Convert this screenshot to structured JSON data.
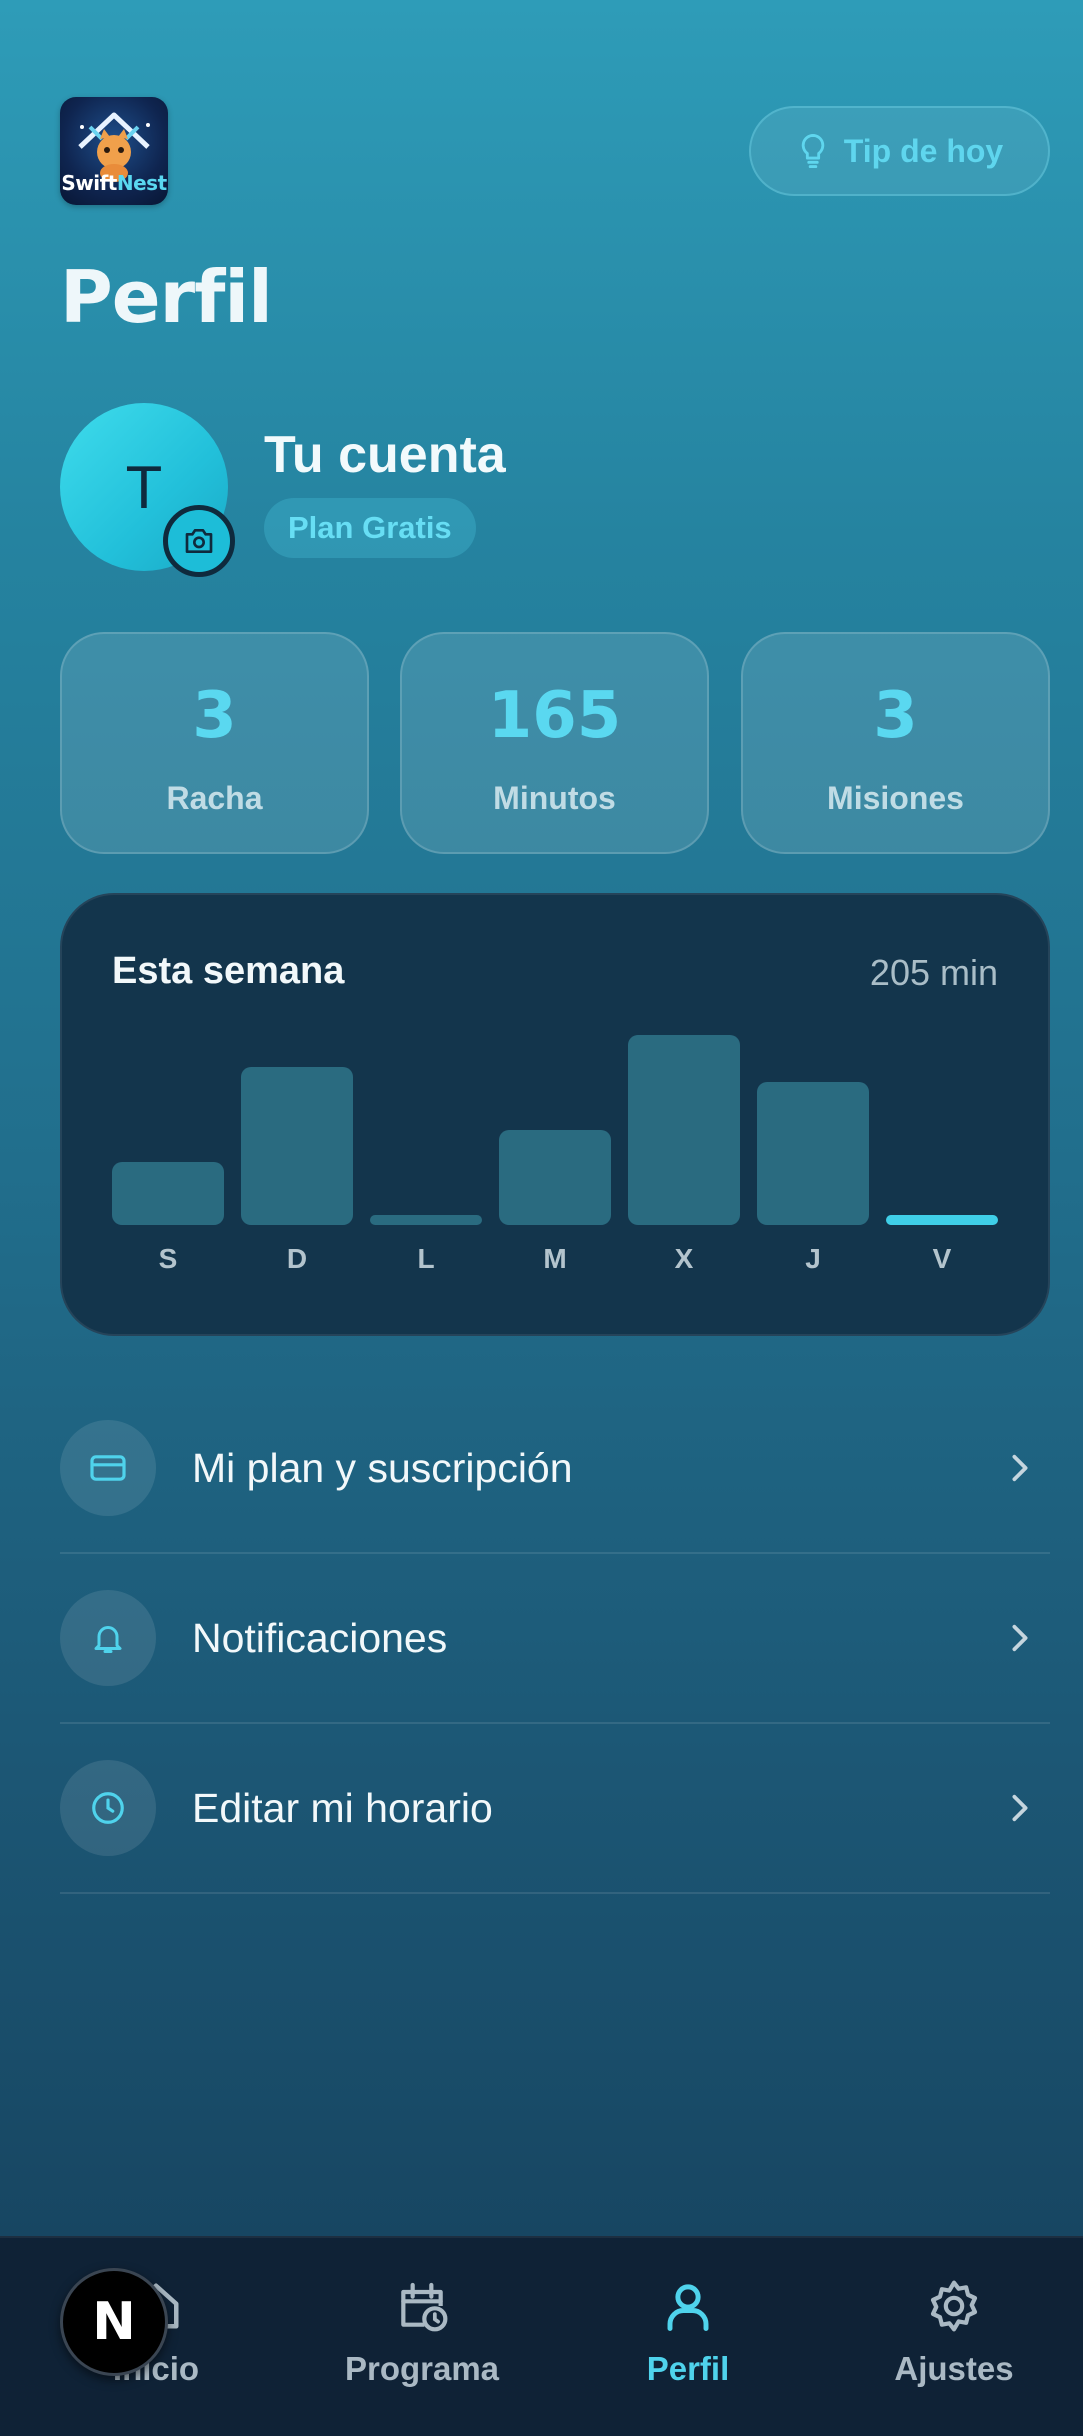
{
  "header": {
    "logo": {
      "name": "Swift",
      "accent": "Nest",
      "icon": "house-cat-logo"
    },
    "tip_button": {
      "label": "Tip de hoy",
      "icon": "lightbulb-icon"
    },
    "title": "Perfil"
  },
  "profile": {
    "avatar_letter": "T",
    "name": "Tu cuenta",
    "plan": "Plan Gratis",
    "camera_icon": "camera-icon"
  },
  "stats": [
    {
      "value": "3",
      "label": "Racha"
    },
    {
      "value": "165",
      "label": "Minutos"
    },
    {
      "value": "3",
      "label": "Misiones"
    }
  ],
  "week": {
    "title": "Esta semana",
    "total": "205 min",
    "chart_data": {
      "type": "bar",
      "categories": [
        "S",
        "D",
        "L",
        "M",
        "X",
        "J",
        "V"
      ],
      "values": [
        20,
        50,
        3,
        30,
        60,
        45,
        3
      ],
      "highlight_index": 6,
      "colors": {
        "bar": "#2a6b80",
        "today": "#3fcfe8"
      }
    }
  },
  "menu": [
    {
      "label": "Mi plan y suscripción",
      "icon": "credit-card-icon"
    },
    {
      "label": "Notificaciones",
      "icon": "bell-icon"
    },
    {
      "label": "Editar mi horario",
      "icon": "clock-icon"
    }
  ],
  "nav": [
    {
      "label": "Inicio",
      "icon": "home-icon",
      "active": false
    },
    {
      "label": "Programa",
      "icon": "calendar-clock-icon",
      "active": false
    },
    {
      "label": "Perfil",
      "icon": "user-icon",
      "active": true
    },
    {
      "label": "Ajustes",
      "icon": "gear-icon",
      "active": false
    }
  ],
  "dev_badge": "N",
  "colors": {
    "accent": "#4fd3ec",
    "card_dark": "#13354c",
    "nav_bg": "#0f2236"
  }
}
